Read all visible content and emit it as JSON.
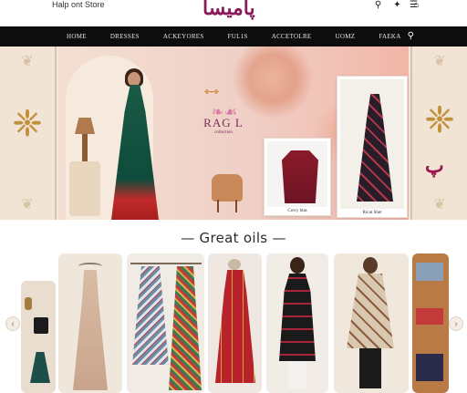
{
  "header": {
    "store_name": "Halp ont Store",
    "logo_text": "پامیسا",
    "icons": [
      "search-icon",
      "twitter-icon",
      "cart-icon",
      "menu-icon"
    ]
  },
  "nav": {
    "items": [
      "HOME",
      "DRESSES",
      "ACKEYORES",
      "FUL1S",
      "ACCETOLRE",
      "UOMZ",
      "FAEKA"
    ],
    "search_icon": "search-icon"
  },
  "hero": {
    "collection_title": "RAG L",
    "collection_subtitle": "collection",
    "card_small_caption": "Crecy htas",
    "card_tall_caption": "Ricut Shet",
    "right_brand_mark": "پ"
  },
  "section": {
    "title": "— Great oils —"
  },
  "products": {
    "prev_label": "‹",
    "next_label": "›"
  },
  "colors": {
    "nav_bg": "#0d0d0d",
    "brand": "#8b1a5b",
    "hero_bg": "#f4e6d8"
  }
}
